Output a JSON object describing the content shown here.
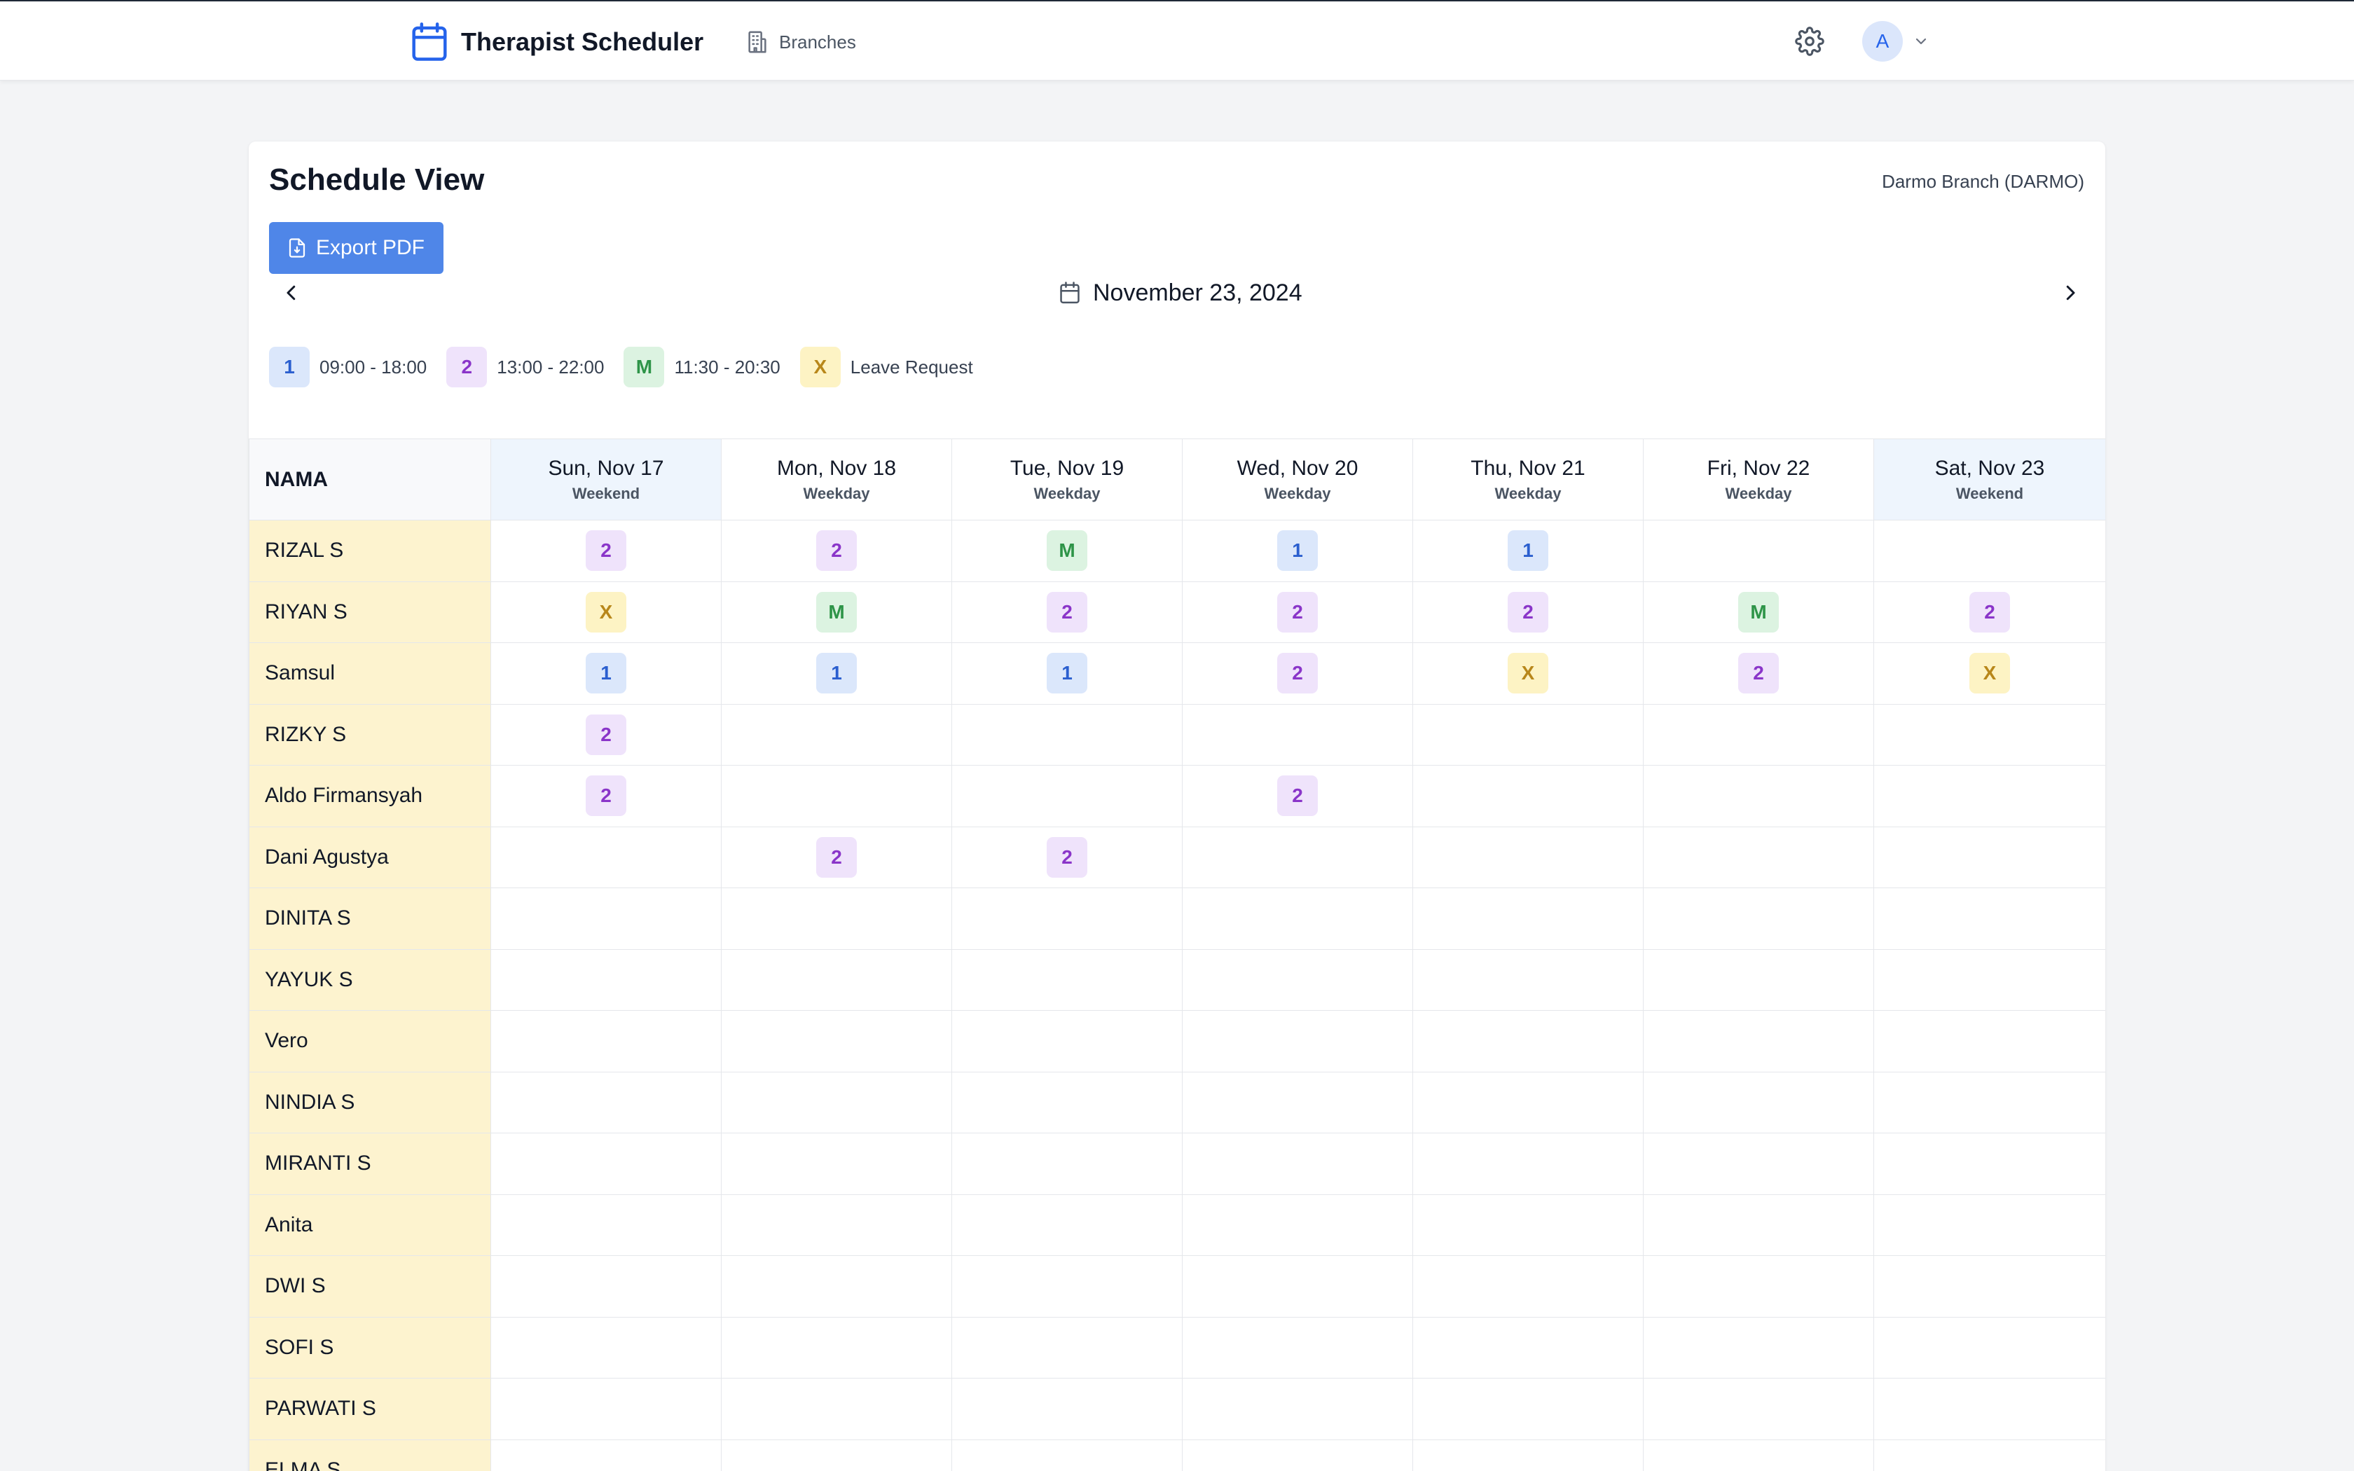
{
  "app": {
    "title": "Therapist Scheduler",
    "nav_branches": "Branches",
    "user_initial": "A",
    "brand_color": "#2563eb"
  },
  "page": {
    "title": "Schedule View",
    "branch": "Darmo Branch (DARMO)",
    "export_label": "Export PDF",
    "current_date": "November 23, 2024"
  },
  "legend": [
    {
      "code": "1",
      "label": "09:00 - 18:00",
      "color": "#dbe7fb"
    },
    {
      "code": "2",
      "label": "13:00 - 22:00",
      "color": "#efe3fb"
    },
    {
      "code": "M",
      "label": "11:30 - 20:30",
      "color": "#dcf3e1"
    },
    {
      "code": "X",
      "label": "Leave Request",
      "color": "#fdf3c4"
    }
  ],
  "table": {
    "name_header": "NAMA",
    "days": [
      {
        "label": "Sun, Nov 17",
        "type": "Weekend"
      },
      {
        "label": "Mon, Nov 18",
        "type": "Weekday"
      },
      {
        "label": "Tue, Nov 19",
        "type": "Weekday"
      },
      {
        "label": "Wed, Nov 20",
        "type": "Weekday"
      },
      {
        "label": "Thu, Nov 21",
        "type": "Weekday"
      },
      {
        "label": "Fri, Nov 22",
        "type": "Weekday"
      },
      {
        "label": "Sat, Nov 23",
        "type": "Weekend"
      }
    ],
    "rows": [
      {
        "name": "RIZAL S",
        "shifts": [
          "2",
          "2",
          "M",
          "1",
          "1",
          "",
          ""
        ]
      },
      {
        "name": "RIYAN S",
        "shifts": [
          "X",
          "M",
          "2",
          "2",
          "2",
          "M",
          "2"
        ]
      },
      {
        "name": "Samsul",
        "shifts": [
          "1",
          "1",
          "1",
          "2",
          "X",
          "2",
          "X"
        ]
      },
      {
        "name": "RIZKY S",
        "shifts": [
          "2",
          "",
          "",
          "",
          "",
          "",
          ""
        ]
      },
      {
        "name": "Aldo Firmansyah",
        "shifts": [
          "2",
          "",
          "",
          "2",
          "",
          "",
          ""
        ]
      },
      {
        "name": "Dani Agustya",
        "shifts": [
          "",
          "2",
          "2",
          "",
          "",
          "",
          ""
        ]
      },
      {
        "name": "DINITA S",
        "shifts": [
          "",
          "",
          "",
          "",
          "",
          "",
          ""
        ]
      },
      {
        "name": "YAYUK S",
        "shifts": [
          "",
          "",
          "",
          "",
          "",
          "",
          ""
        ]
      },
      {
        "name": "Vero",
        "shifts": [
          "",
          "",
          "",
          "",
          "",
          "",
          ""
        ]
      },
      {
        "name": "NINDIA S",
        "shifts": [
          "",
          "",
          "",
          "",
          "",
          "",
          ""
        ]
      },
      {
        "name": "MIRANTI S",
        "shifts": [
          "",
          "",
          "",
          "",
          "",
          "",
          ""
        ]
      },
      {
        "name": "Anita",
        "shifts": [
          "",
          "",
          "",
          "",
          "",
          "",
          ""
        ]
      },
      {
        "name": "DWI S",
        "shifts": [
          "",
          "",
          "",
          "",
          "",
          "",
          ""
        ]
      },
      {
        "name": "SOFI S",
        "shifts": [
          "",
          "",
          "",
          "",
          "",
          "",
          ""
        ]
      },
      {
        "name": "PARWATI S",
        "shifts": [
          "",
          "",
          "",
          "",
          "",
          "",
          ""
        ]
      },
      {
        "name": "ELMA S",
        "shifts": [
          "",
          "",
          "",
          "",
          "",
          "",
          ""
        ]
      }
    ]
  }
}
